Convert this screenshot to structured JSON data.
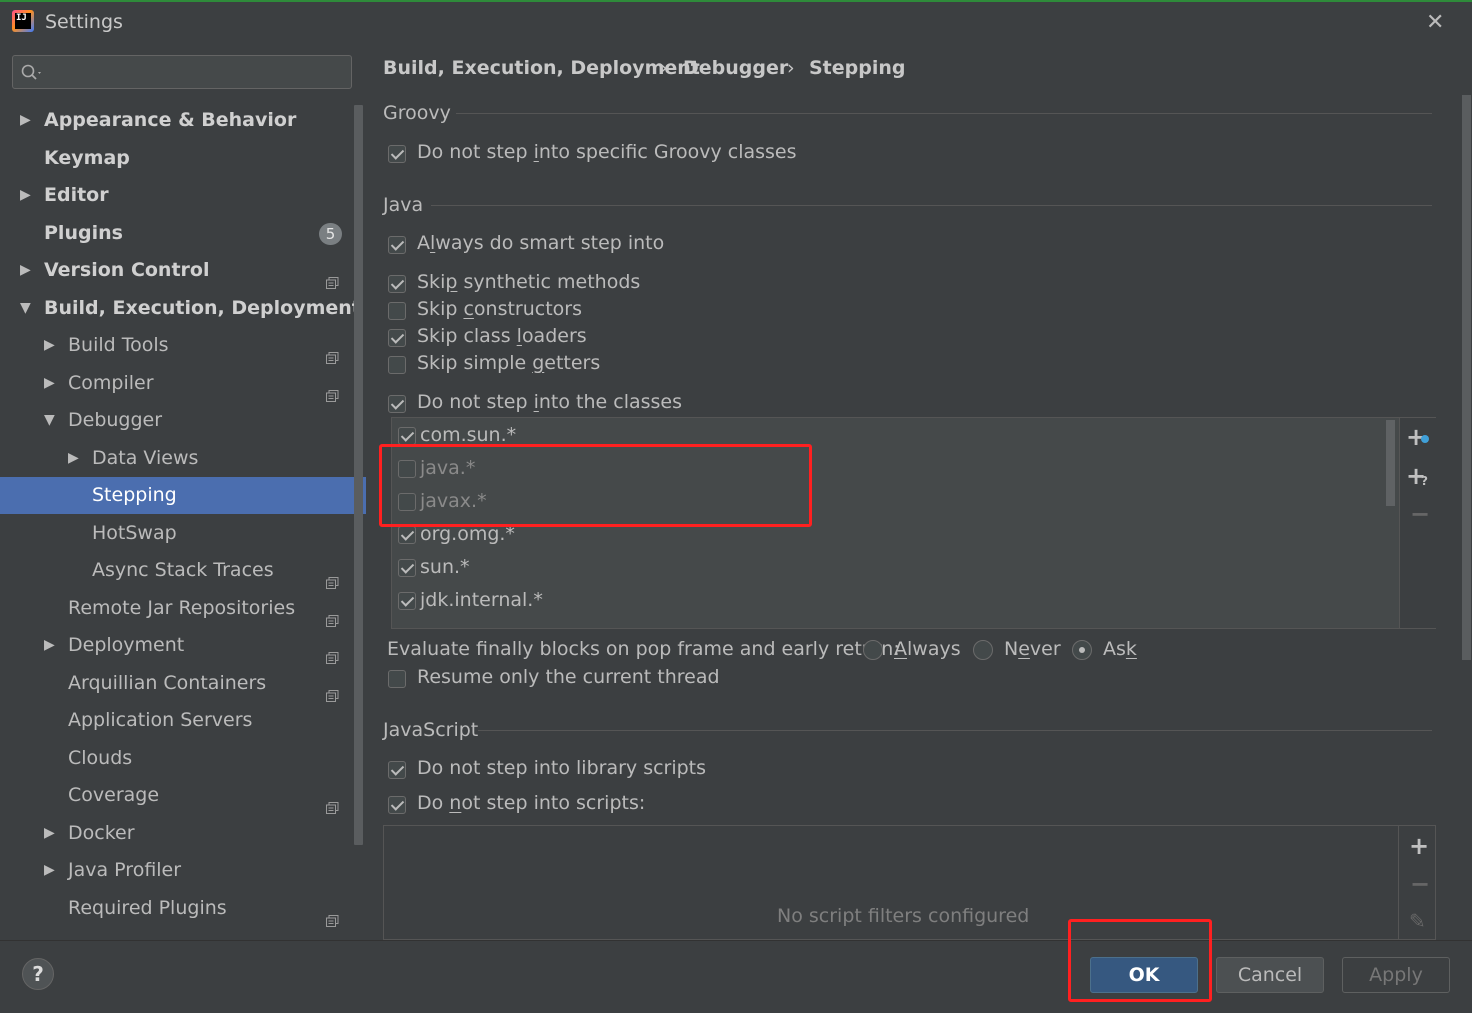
{
  "window": {
    "title": "Settings"
  },
  "search": {
    "value": ""
  },
  "sidebar": {
    "items": [
      {
        "label": "Appearance & Behavior",
        "level": 0,
        "expander": "collapsed",
        "bold": true,
        "project_icon": false
      },
      {
        "label": "Keymap",
        "level": 0,
        "expander": "none",
        "bold": true,
        "project_icon": false
      },
      {
        "label": "Editor",
        "level": 0,
        "expander": "collapsed",
        "bold": true,
        "project_icon": false
      },
      {
        "label": "Plugins",
        "level": 0,
        "expander": "none",
        "bold": true,
        "badge": "5"
      },
      {
        "label": "Version Control",
        "level": 0,
        "expander": "collapsed",
        "bold": true,
        "project_icon": true
      },
      {
        "label": "Build, Execution, Deployment",
        "level": 0,
        "expander": "expanded",
        "bold": true,
        "project_icon": false
      },
      {
        "label": "Build Tools",
        "level": 1,
        "expander": "collapsed",
        "project_icon": true
      },
      {
        "label": "Compiler",
        "level": 1,
        "expander": "collapsed",
        "project_icon": true
      },
      {
        "label": "Debugger",
        "level": 1,
        "expander": "expanded",
        "project_icon": false
      },
      {
        "label": "Data Views",
        "level": 2,
        "expander": "collapsed",
        "project_icon": false
      },
      {
        "label": "Stepping",
        "level": 2,
        "expander": "none",
        "selected": true,
        "project_icon": false
      },
      {
        "label": "HotSwap",
        "level": 2,
        "expander": "none",
        "project_icon": false
      },
      {
        "label": "Async Stack Traces",
        "level": 2,
        "expander": "none",
        "project_icon": true
      },
      {
        "label": "Remote Jar Repositories",
        "level": 1,
        "expander": "none",
        "project_icon": true
      },
      {
        "label": "Deployment",
        "level": 1,
        "expander": "collapsed",
        "project_icon": true
      },
      {
        "label": "Arquillian Containers",
        "level": 1,
        "expander": "none",
        "project_icon": true
      },
      {
        "label": "Application Servers",
        "level": 1,
        "expander": "none",
        "project_icon": false
      },
      {
        "label": "Clouds",
        "level": 1,
        "expander": "none",
        "project_icon": false
      },
      {
        "label": "Coverage",
        "level": 1,
        "expander": "none",
        "project_icon": true
      },
      {
        "label": "Docker",
        "level": 1,
        "expander": "collapsed",
        "project_icon": false
      },
      {
        "label": "Java Profiler",
        "level": 1,
        "expander": "collapsed",
        "project_icon": false
      },
      {
        "label": "Required Plugins",
        "level": 1,
        "expander": "none",
        "project_icon": true
      }
    ]
  },
  "breadcrumb": [
    "Build, Execution, Deployment",
    "Debugger",
    "Stepping"
  ],
  "breadcrumb_separator": "›",
  "groovy": {
    "title": "Groovy",
    "do_not_step_groovy": {
      "pre": "Do not step ",
      "mnemonic": "i",
      "post": "nto specific Groovy classes",
      "checked": true
    }
  },
  "java": {
    "title": "Java",
    "smart_step": {
      "pre": "A",
      "mnemonic": "l",
      "post": "ways do smart step into",
      "checked": true
    },
    "skip_synthetic": {
      "pre": "Ski",
      "mnemonic": "p",
      "post": " synthetic methods",
      "checked": true
    },
    "skip_constructors": {
      "pre": "Skip ",
      "mnemonic": "c",
      "post": "onstructors",
      "checked": false
    },
    "skip_class_loaders": {
      "pre": "Skip class ",
      "mnemonic": "l",
      "post": "oaders",
      "checked": true
    },
    "skip_simple_getters": {
      "pre": "Skip simple ",
      "mnemonic": "g",
      "post": "etters",
      "checked": false
    },
    "do_not_step_classes": {
      "pre": "Do not step ",
      "mnemonic": "i",
      "post": "nto the classes",
      "checked": true
    },
    "class_filters": [
      {
        "pattern": "com.sun.*",
        "enabled": true
      },
      {
        "pattern": "java.*",
        "enabled": false
      },
      {
        "pattern": "javax.*",
        "enabled": false
      },
      {
        "pattern": "org.omg.*",
        "enabled": true
      },
      {
        "pattern": "sun.*",
        "enabled": true
      },
      {
        "pattern": "jdk.internal.*",
        "enabled": true
      }
    ],
    "evaluate_finally": {
      "label": "Evaluate finally blocks on pop frame and early return:",
      "options": [
        {
          "pre": "",
          "mnemonic": "A",
          "post": "lways",
          "selected": false
        },
        {
          "pre": "N",
          "mnemonic": "e",
          "post": "ver",
          "selected": false
        },
        {
          "pre": "As",
          "mnemonic": "k",
          "post": "",
          "selected": true
        }
      ]
    },
    "resume_only_current": {
      "pre": "Resume only the current thread",
      "mnemonic": "",
      "post": "",
      "checked": false
    }
  },
  "javascript": {
    "title": "JavaScript",
    "do_not_step_library": {
      "pre": "Do not step into library scripts",
      "mnemonic": "",
      "post": "",
      "checked": true
    },
    "do_not_step_scripts": {
      "pre": "Do ",
      "mnemonic": "n",
      "post": "ot step into scripts:",
      "checked": true
    },
    "empty_text": "No script filters configured"
  },
  "footer": {
    "help": "?",
    "ok_label": "OK",
    "cancel_label": "Cancel",
    "apply_label": "Apply"
  },
  "colors": {
    "background": "#3c3f41",
    "selection": "#4b6eaf",
    "highlight_box": "#ff2020",
    "ok_button": "#365880"
  }
}
